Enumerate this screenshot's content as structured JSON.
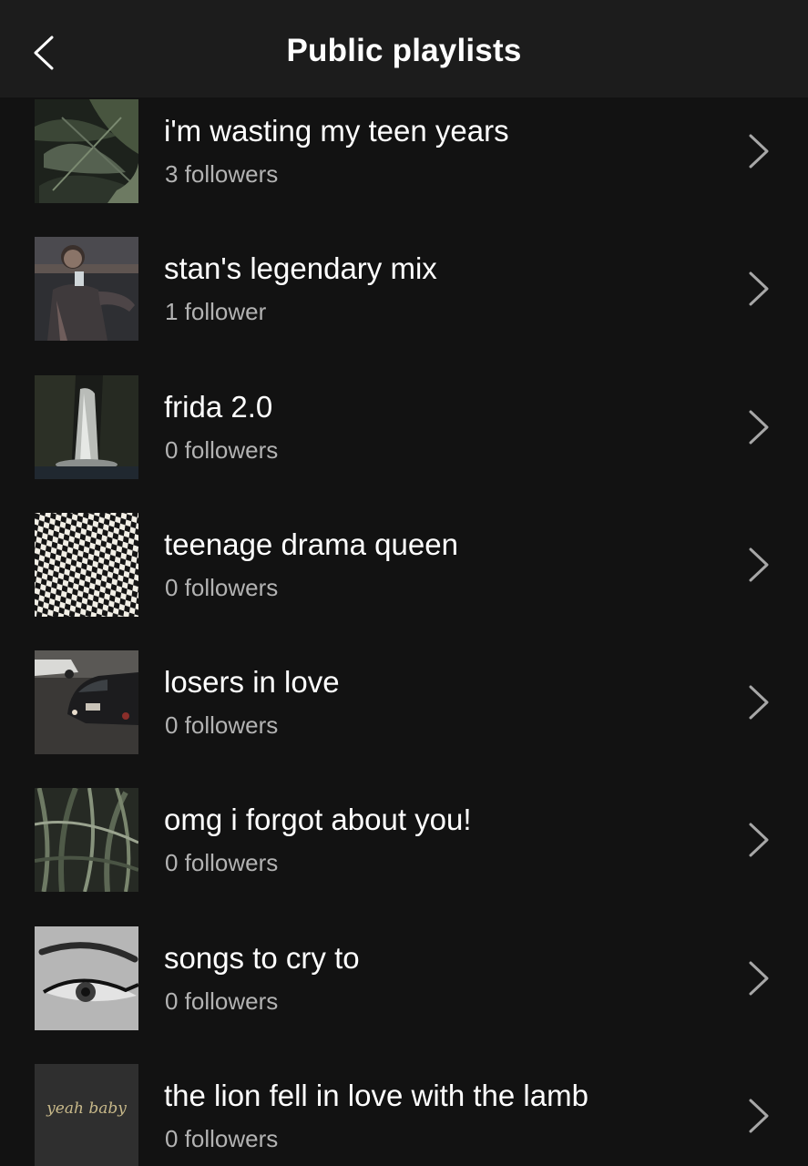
{
  "header": {
    "title": "Public playlists",
    "back_icon": "chevron-left-icon"
  },
  "playlists": [
    {
      "title": "i'm wasting my teen years",
      "followers": "3 followers",
      "thumb": "tropical-leaves"
    },
    {
      "title": "stan's legendary mix",
      "followers": "1 follower",
      "thumb": "person-with-cup"
    },
    {
      "title": "frida 2.0",
      "followers": "0 followers",
      "thumb": "waterfall"
    },
    {
      "title": "teenage drama queen",
      "followers": "0 followers",
      "thumb": "checkerboard"
    },
    {
      "title": "losers in love",
      "followers": "0 followers",
      "thumb": "vintage-car"
    },
    {
      "title": "omg i forgot about you!",
      "followers": "0 followers",
      "thumb": "tall-grass"
    },
    {
      "title": "songs to cry to",
      "followers": "0 followers",
      "thumb": "eye-makeup"
    },
    {
      "title": "the lion fell in love with the lamb",
      "followers": "0 followers",
      "thumb": "yeah-baby-text",
      "thumb_text": "yeah baby"
    }
  ],
  "colors": {
    "background": "#121212",
    "header": "#1c1c1c",
    "subtitle": "#b3b3b3",
    "chevron": "#a7a7a7"
  }
}
